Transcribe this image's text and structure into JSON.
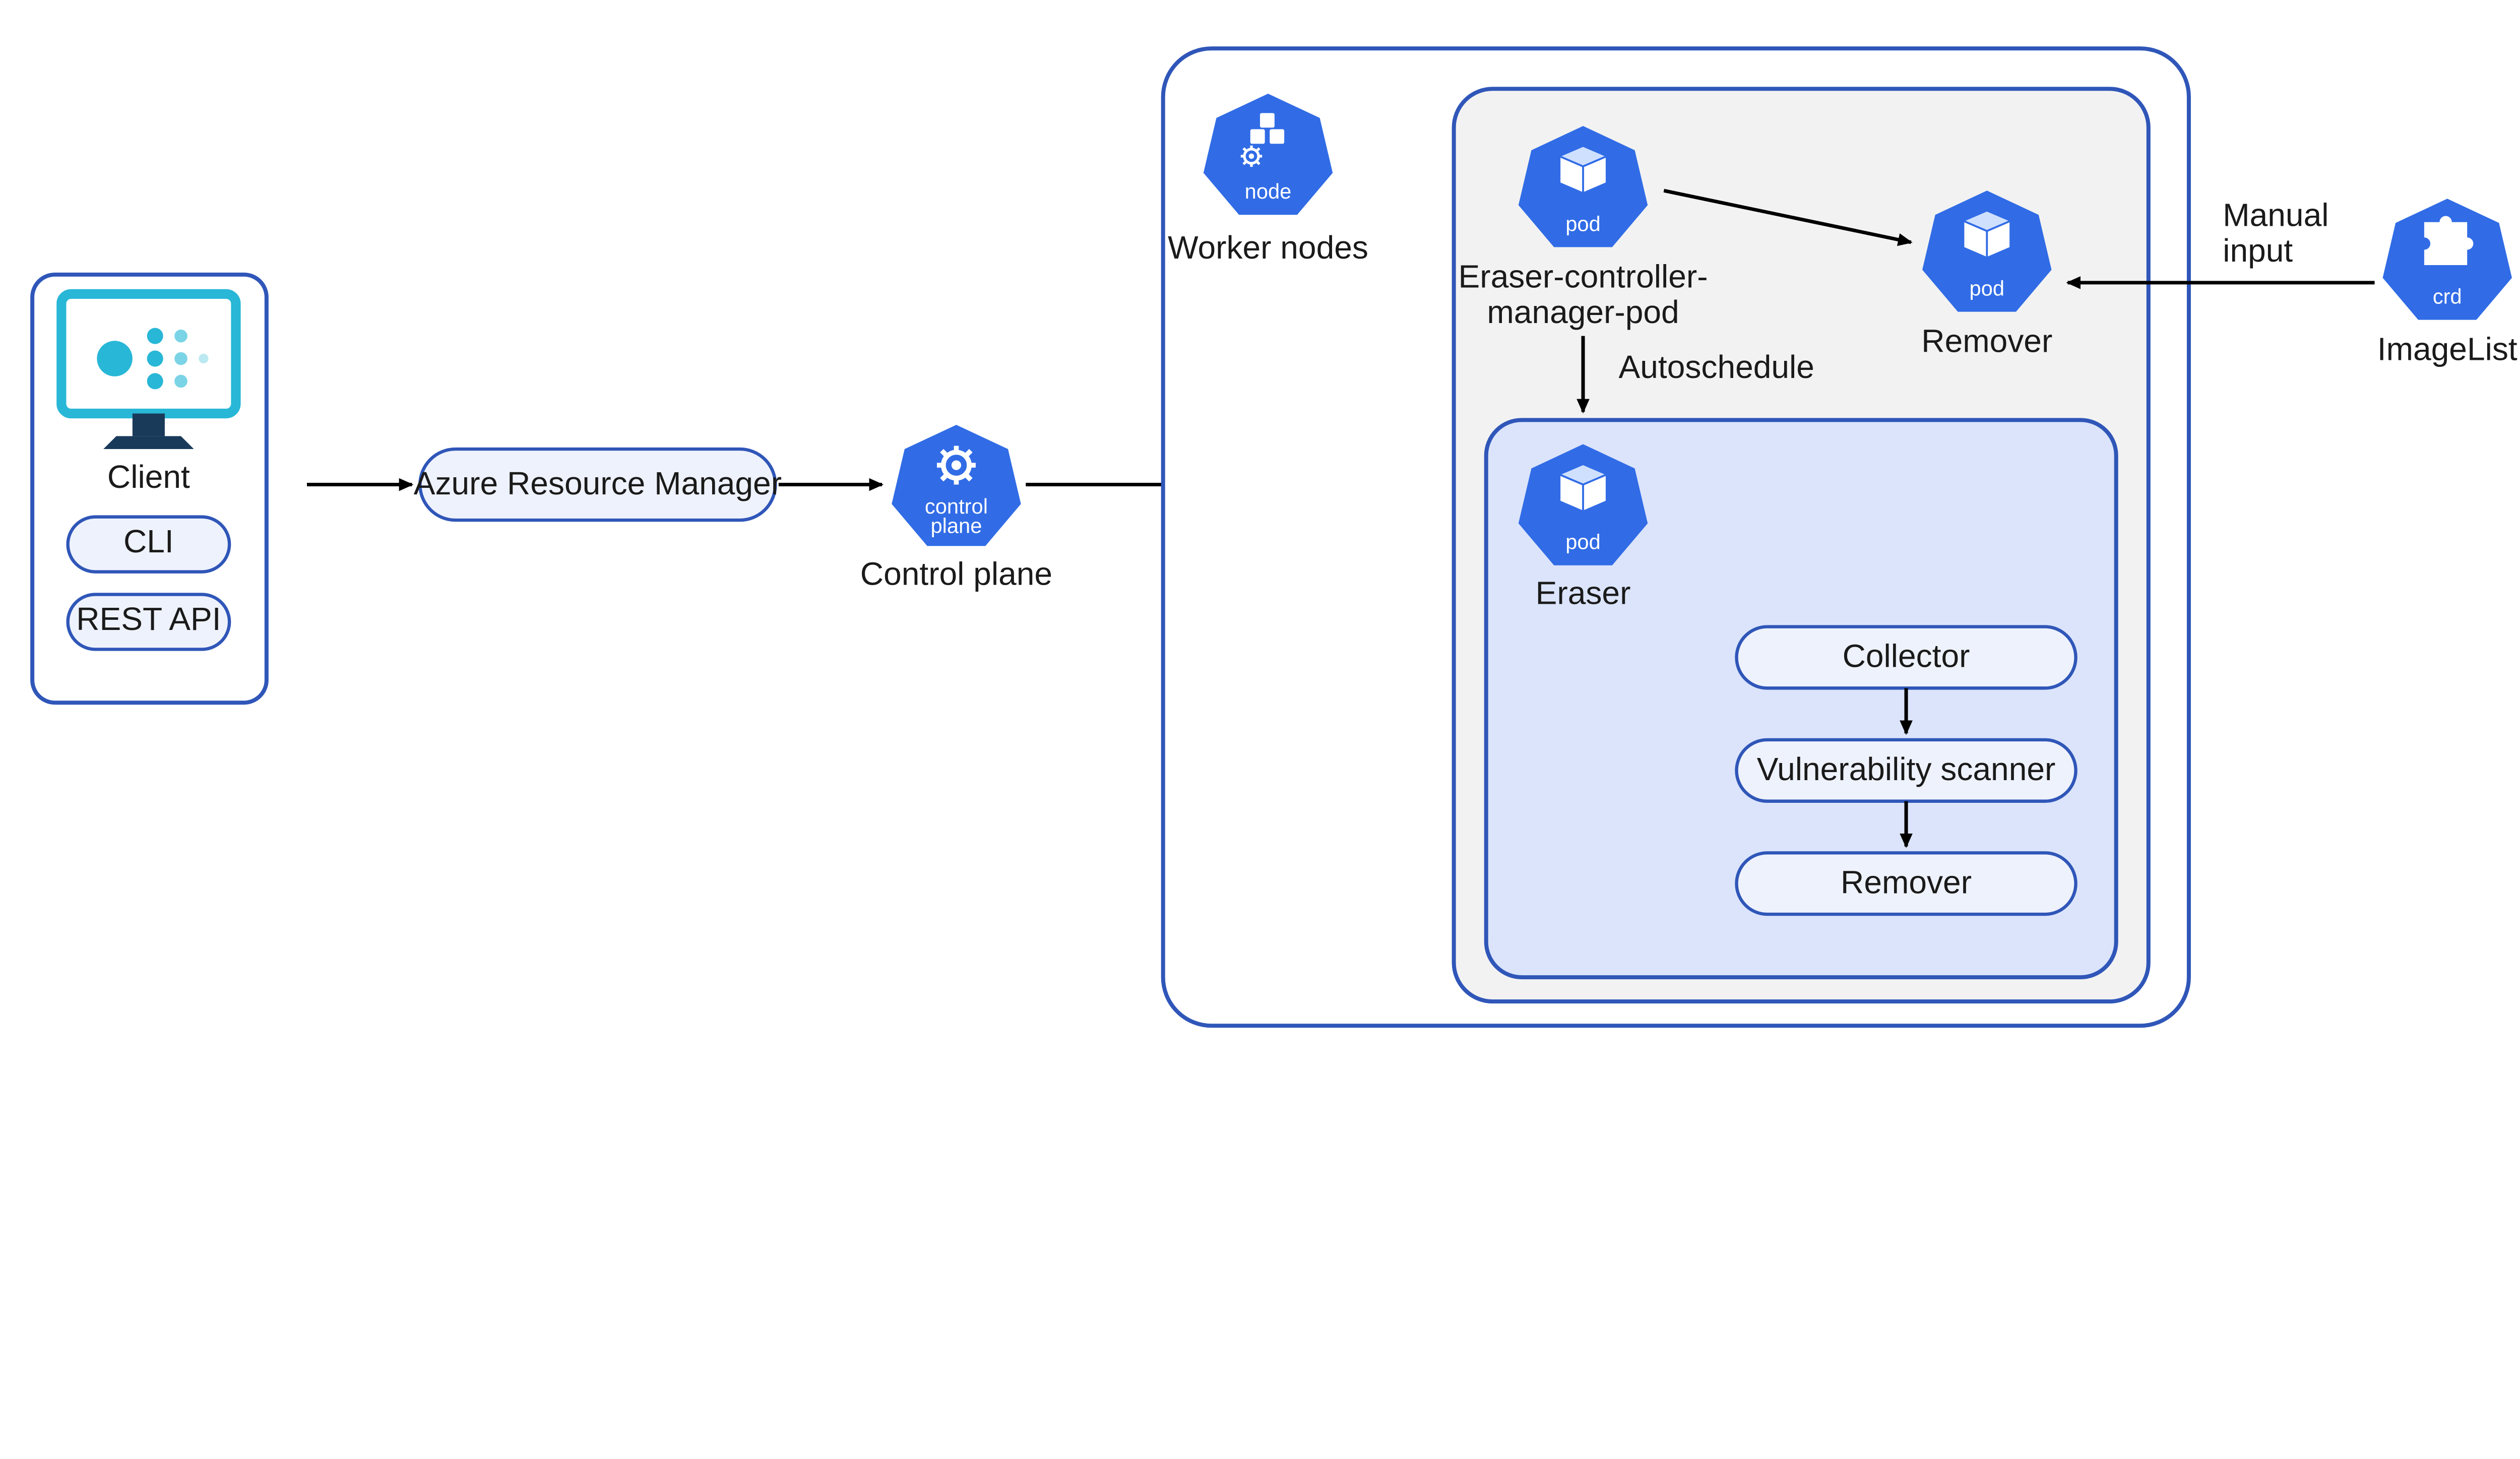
{
  "client": {
    "title": "Client",
    "cli": "CLI",
    "rest": "REST API"
  },
  "arm": {
    "label": "Azure Resource Manager"
  },
  "controlPlane": {
    "label": "Control plane",
    "iconText": "control\nplane"
  },
  "workerNodes": {
    "label": "Worker nodes",
    "iconText": "node"
  },
  "eraserController": {
    "labelLines": [
      "Eraser-controller-",
      "manager-pod"
    ],
    "iconText": "pod"
  },
  "remover": {
    "label": "Remover",
    "iconText": "pod"
  },
  "autoschedule": "Autoschedule",
  "eraser": {
    "label": "Eraser",
    "iconText": "pod"
  },
  "pipeline": {
    "collector": "Collector",
    "scanner": "Vulnerability scanner",
    "remover": "Remover"
  },
  "manualInput": {
    "lines": [
      "Manual",
      "input"
    ]
  },
  "imageList": {
    "label": "ImageList",
    "iconText": "crd"
  },
  "colors": {
    "azureBlue": "#316ce6",
    "outlineBlue": "#2f56b8",
    "lightFill": "#eef2fc",
    "greyFill": "#f2f2f2",
    "blueFill": "#dbe4fb",
    "monitorCyan": "#28b7d6"
  }
}
